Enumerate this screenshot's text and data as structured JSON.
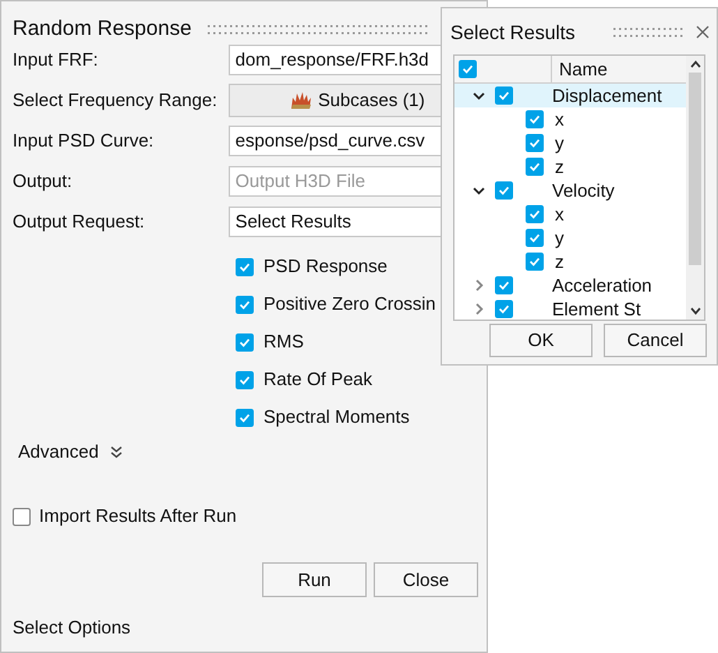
{
  "panel": {
    "title": "Random Response",
    "fields": [
      {
        "kind": "text",
        "label": "Input FRF:",
        "value": "dom_response/FRF.h3d"
      },
      {
        "kind": "button",
        "label": "Select Frequency Range:",
        "value": "Subcases (1)"
      },
      {
        "kind": "text",
        "label": "Input PSD Curve:",
        "value": "esponse/psd_curve.csv"
      },
      {
        "kind": "placeholder",
        "label": "Output:",
        "placeholder": "Output H3D File"
      },
      {
        "kind": "text",
        "label": "Output Request:",
        "value": "Select Results"
      }
    ],
    "options": [
      {
        "label": "PSD Response",
        "checked": true
      },
      {
        "label": "Positive Zero Crossin",
        "checked": true
      },
      {
        "label": "RMS",
        "checked": true
      },
      {
        "label": "Rate Of Peak",
        "checked": true
      },
      {
        "label": "Spectral Moments",
        "checked": true
      }
    ],
    "advanced": {
      "label": "Advanced",
      "expanded": false
    },
    "import_results": {
      "label": "Import Results After Run",
      "checked": false
    },
    "buttons": [
      "Run",
      "Close"
    ],
    "status": "Select Options"
  },
  "popup": {
    "title": "Select Results",
    "header": {
      "checked": true,
      "column": "Name"
    },
    "tree": [
      {
        "label": "Displacement",
        "checked": true,
        "expanded": true,
        "selected": true,
        "children": [
          {
            "label": "x",
            "checked": true,
            "selected": false
          },
          {
            "label": "y",
            "checked": true,
            "selected": false
          },
          {
            "label": "z",
            "checked": true,
            "selected": false
          }
        ]
      },
      {
        "label": "Velocity",
        "checked": true,
        "expanded": true,
        "selected": false,
        "children": [
          {
            "label": "x",
            "checked": true,
            "selected": false
          },
          {
            "label": "y",
            "checked": true,
            "selected": false
          },
          {
            "label": "z",
            "checked": true,
            "selected": false
          }
        ]
      },
      {
        "label": "Acceleration",
        "checked": true,
        "expanded": false,
        "selected": false
      },
      {
        "label": "Element St",
        "checked": true,
        "expanded": false,
        "selected": false
      }
    ],
    "buttons": [
      "OK",
      "Cancel"
    ]
  }
}
